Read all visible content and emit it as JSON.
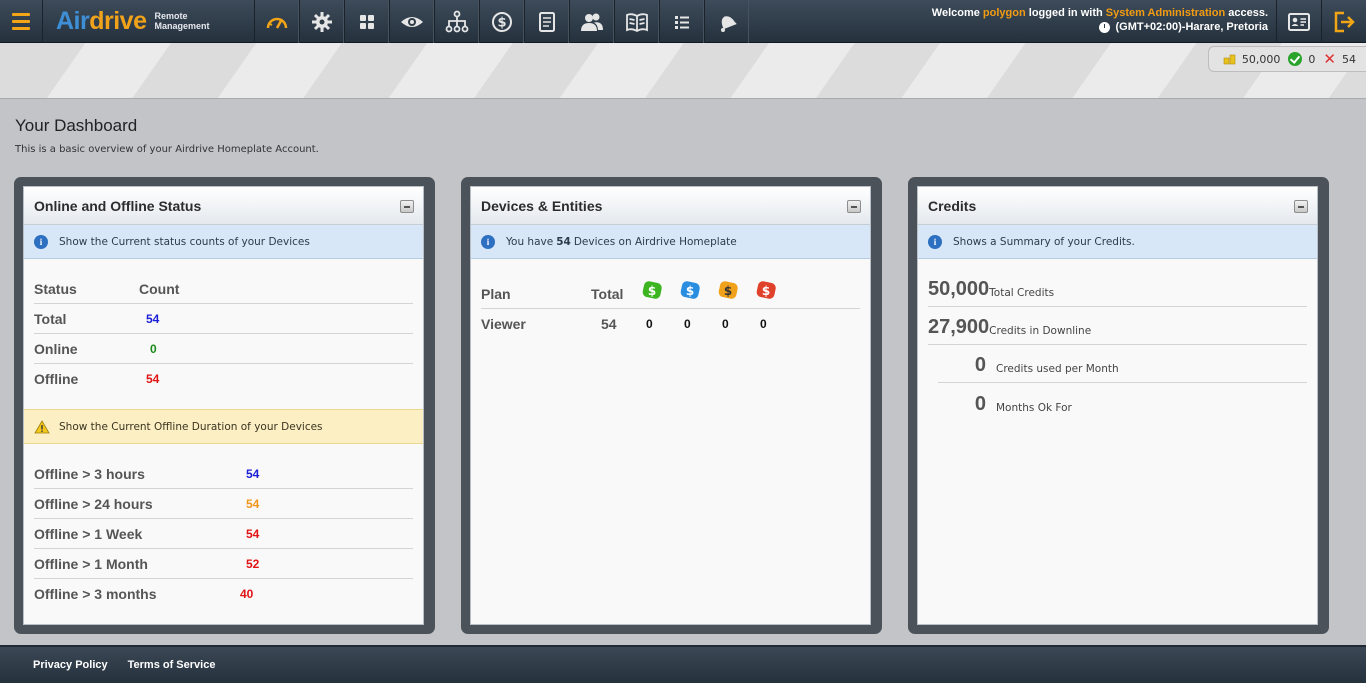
{
  "brand": {
    "name_part1": "Air",
    "name_part2": "drive",
    "sub_line1": "Remote",
    "sub_line2": "Management"
  },
  "nav": [
    {
      "name": "dashboard-gauge-icon"
    },
    {
      "name": "settings-gear-icon"
    },
    {
      "name": "apps-grid-icon"
    },
    {
      "name": "eye-view-icon"
    },
    {
      "name": "hierarchy-tree-icon"
    },
    {
      "name": "dollar-globe-icon"
    },
    {
      "name": "document-icon"
    },
    {
      "name": "users-icon"
    },
    {
      "name": "book-icon"
    },
    {
      "name": "list-icon"
    },
    {
      "name": "bell-icon"
    }
  ],
  "welcome": {
    "prefix": "Welcome",
    "user": "polygon",
    "mid": "logged in with",
    "access": "System Administration",
    "suffix": "access.",
    "timezone": "(GMT+02:00)-Harare, Pretoria"
  },
  "credit_pill": {
    "credits": "50,000",
    "ok": "0",
    "fail": "54"
  },
  "page": {
    "title": "Your Dashboard",
    "subtitle": "This is a basic overview of your Airdrive Homeplate Account."
  },
  "status_panel": {
    "title": "Online and Offline Status",
    "info": "Show the Current status counts of your Devices",
    "col_status": "Status",
    "col_count": "Count",
    "rows": [
      {
        "label": "Total",
        "value": "54"
      },
      {
        "label": "Online",
        "value": "0"
      },
      {
        "label": "Offline",
        "value": "54"
      }
    ],
    "warn": "Show the Current Offline Duration of your Devices",
    "durations": [
      {
        "label": "Offline > 3 hours",
        "value": "54"
      },
      {
        "label": "Offline > 24 hours",
        "value": "54"
      },
      {
        "label": "Offline > 1 Week",
        "value": "54"
      },
      {
        "label": "Offline > 1 Month",
        "value": "52"
      },
      {
        "label": "Offline > 3 months",
        "value": "40"
      }
    ]
  },
  "devices_panel": {
    "title": "Devices & Entities",
    "info_pre": "You have",
    "info_count": "54",
    "info_post": "Devices on Airdrive Homeplate",
    "col_plan": "Plan",
    "col_total": "Total",
    "row": {
      "plan": "Viewer",
      "total": "54",
      "c1": "0",
      "c2": "0",
      "c3": "0",
      "c4": "0"
    },
    "colors": {
      "green": "#3cb521",
      "blue": "#2a8ee0",
      "orange": "#f0a21b",
      "red": "#e0412b"
    }
  },
  "credits_panel": {
    "title": "Credits",
    "info": "Shows a Summary of your Credits.",
    "rows": [
      {
        "value": "50,000",
        "label": "Total Credits"
      },
      {
        "value": "27,900",
        "label": "Credits in Downline"
      },
      {
        "value": "0",
        "label": "Credits used per Month"
      },
      {
        "value": "0",
        "label": "Months Ok For"
      }
    ]
  },
  "footer": {
    "privacy": "Privacy Policy",
    "terms": "Terms of Service"
  }
}
